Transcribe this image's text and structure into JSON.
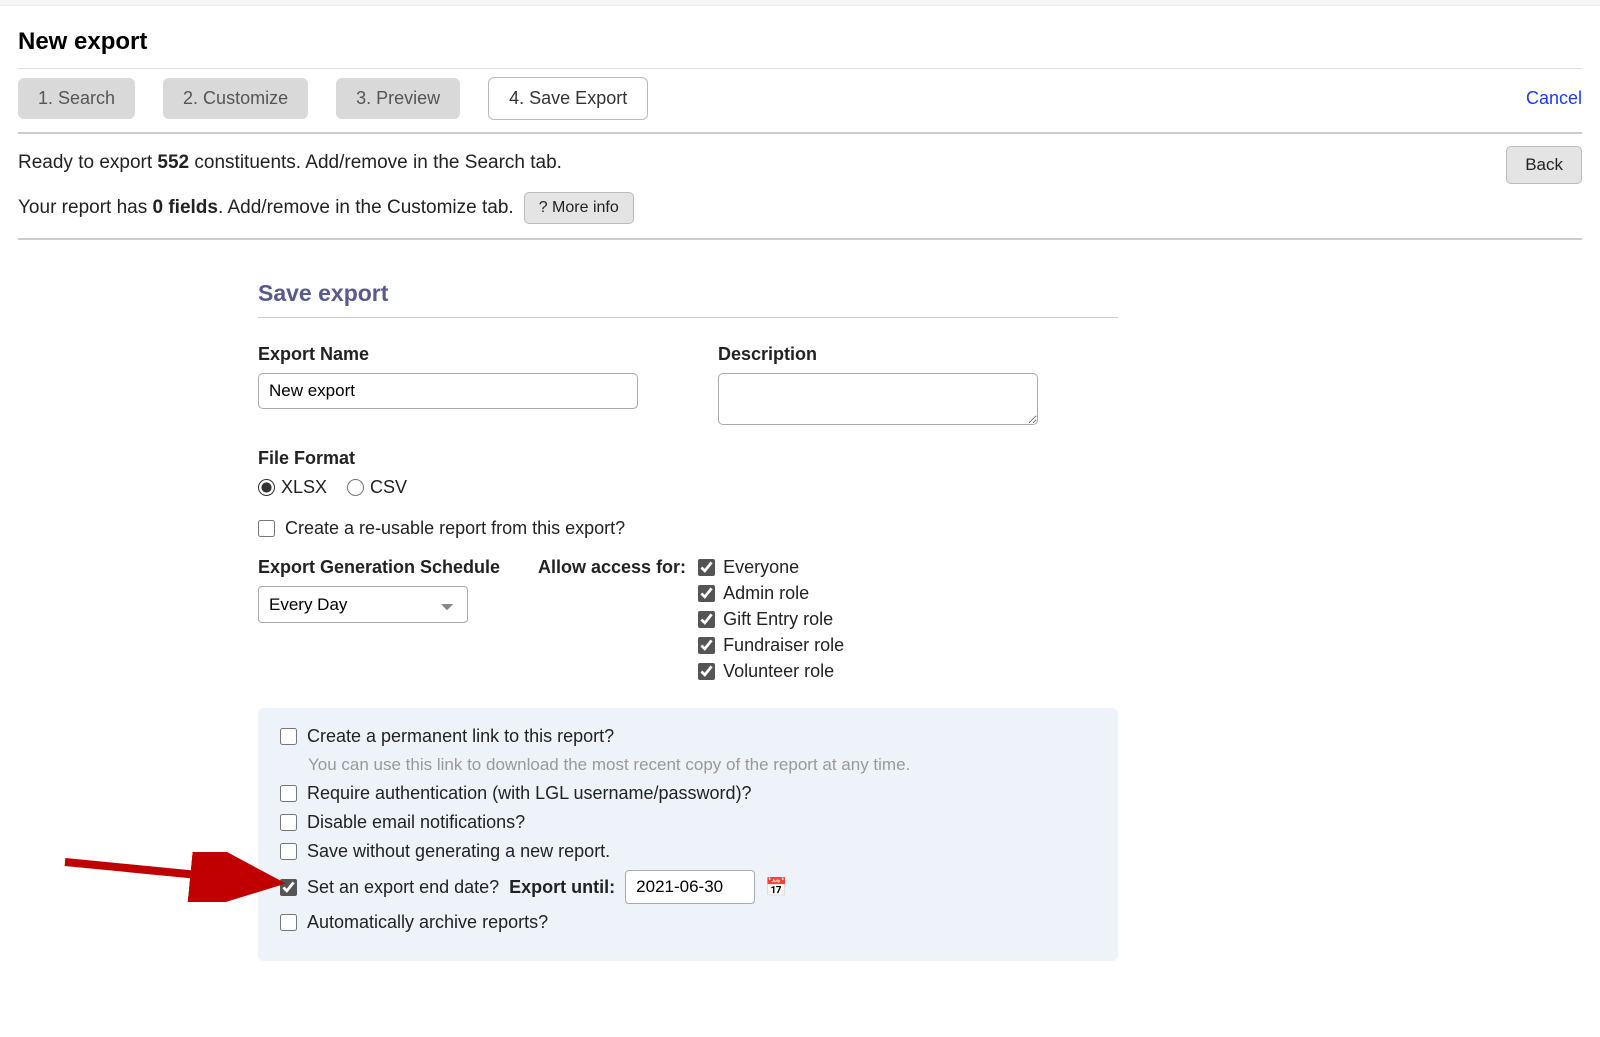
{
  "header": {
    "title": "New export"
  },
  "tabs": {
    "search": "1. Search",
    "customize": "2. Customize",
    "preview": "3. Preview",
    "save_export": "4. Save Export",
    "cancel": "Cancel"
  },
  "status": {
    "ready_prefix": "Ready to export ",
    "count": "552",
    "ready_suffix": " constituents. Add/remove in the Search tab.",
    "fields_prefix": "Your report has ",
    "fields_count": "0 fields",
    "fields_suffix": ". Add/remove in the Customize tab.",
    "more_info": "? More info",
    "back": "Back"
  },
  "form": {
    "section_title": "Save export",
    "export_name_label": "Export Name",
    "export_name_value": "New export",
    "description_label": "Description",
    "description_value": "",
    "file_format_label": "File Format",
    "format_xlsx": "XLSX",
    "format_csv": "CSV",
    "reusable_label": "Create a re-usable report from this export?",
    "schedule_label": "Export Generation Schedule",
    "schedule_value": "Every Day",
    "access_label": "Allow access for:",
    "access": {
      "everyone": "Everyone",
      "admin": "Admin role",
      "gift": "Gift Entry role",
      "fundraiser": "Fundraiser role",
      "volunteer": "Volunteer role"
    },
    "opts": {
      "permalink": "Create a permanent link to this report?",
      "permalink_hint": "You can use this link to download the most recent copy of the report at any time.",
      "require_auth": "Require authentication (with LGL username/password)?",
      "disable_email": "Disable email notifications?",
      "save_no_gen": "Save without generating a new report.",
      "end_date": "Set an export end date?",
      "export_until": "Export until:",
      "date_value": "2021-06-30",
      "auto_archive": "Automatically archive reports?"
    }
  }
}
